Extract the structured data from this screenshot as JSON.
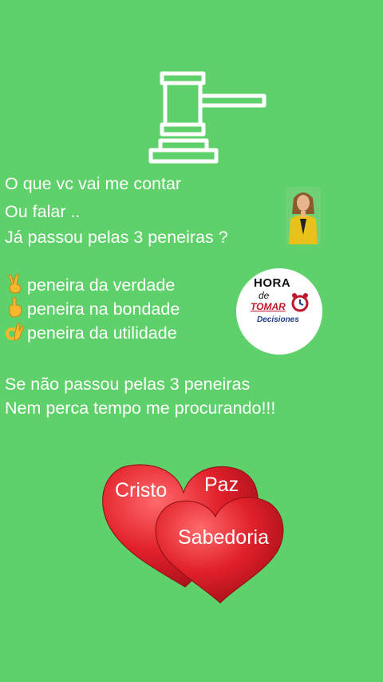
{
  "lines": {
    "l1": "O que vc vai me contar",
    "l2": "Ou falar ..",
    "l3": "Já passou pelas 3 peneiras ?",
    "sieve1": "peneira da verdade",
    "sieve2": "peneira na bondade",
    "sieve3": "peneira da utilidade",
    "l4": "Se não passou pelas 3 peneiras",
    "l5": "Nem perca tempo me procurando!!!"
  },
  "badge": {
    "hora": "HORA",
    "de": "de",
    "tomar": "TOMAR",
    "decisiones": "Decisiones"
  },
  "hearts": {
    "left": "Cristo",
    "top": "Paz",
    "front": "Sabedoria"
  },
  "icons": {
    "gavel": "gavel-icon",
    "sieve1": "victory-hand-emoji",
    "sieve2": "pointing-down-emoji",
    "sieve3": "ok-hand-emoji"
  },
  "colors": {
    "background": "#5fd16a",
    "heart": "#e0202a",
    "text": "#ffffff"
  }
}
